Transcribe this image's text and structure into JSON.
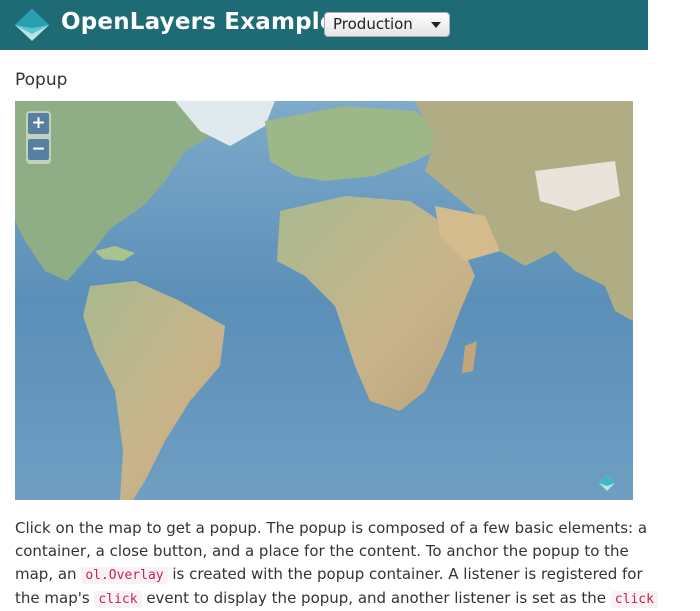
{
  "header": {
    "brand": "OpenLayers Examples",
    "select_value": "Production",
    "colors": {
      "navbar": "#1f6b75",
      "accent": "#41b6c4"
    }
  },
  "page": {
    "title": "Popup"
  },
  "map": {
    "zoom_in_label": "+",
    "zoom_out_label": "−",
    "attribution_icon": "openlayers-logo-icon"
  },
  "description": {
    "part1": "Click on the map to get a popup. The popup is composed of a few basic elements: a container, a close button, and a place for the content. To anchor the popup to the map, an ",
    "code1": "ol.Overlay",
    "part2": " is created with the popup container. A listener is registered for the map's ",
    "code2": "click",
    "part3": " event to display the popup, and another listener is set as the ",
    "code3": "click"
  }
}
